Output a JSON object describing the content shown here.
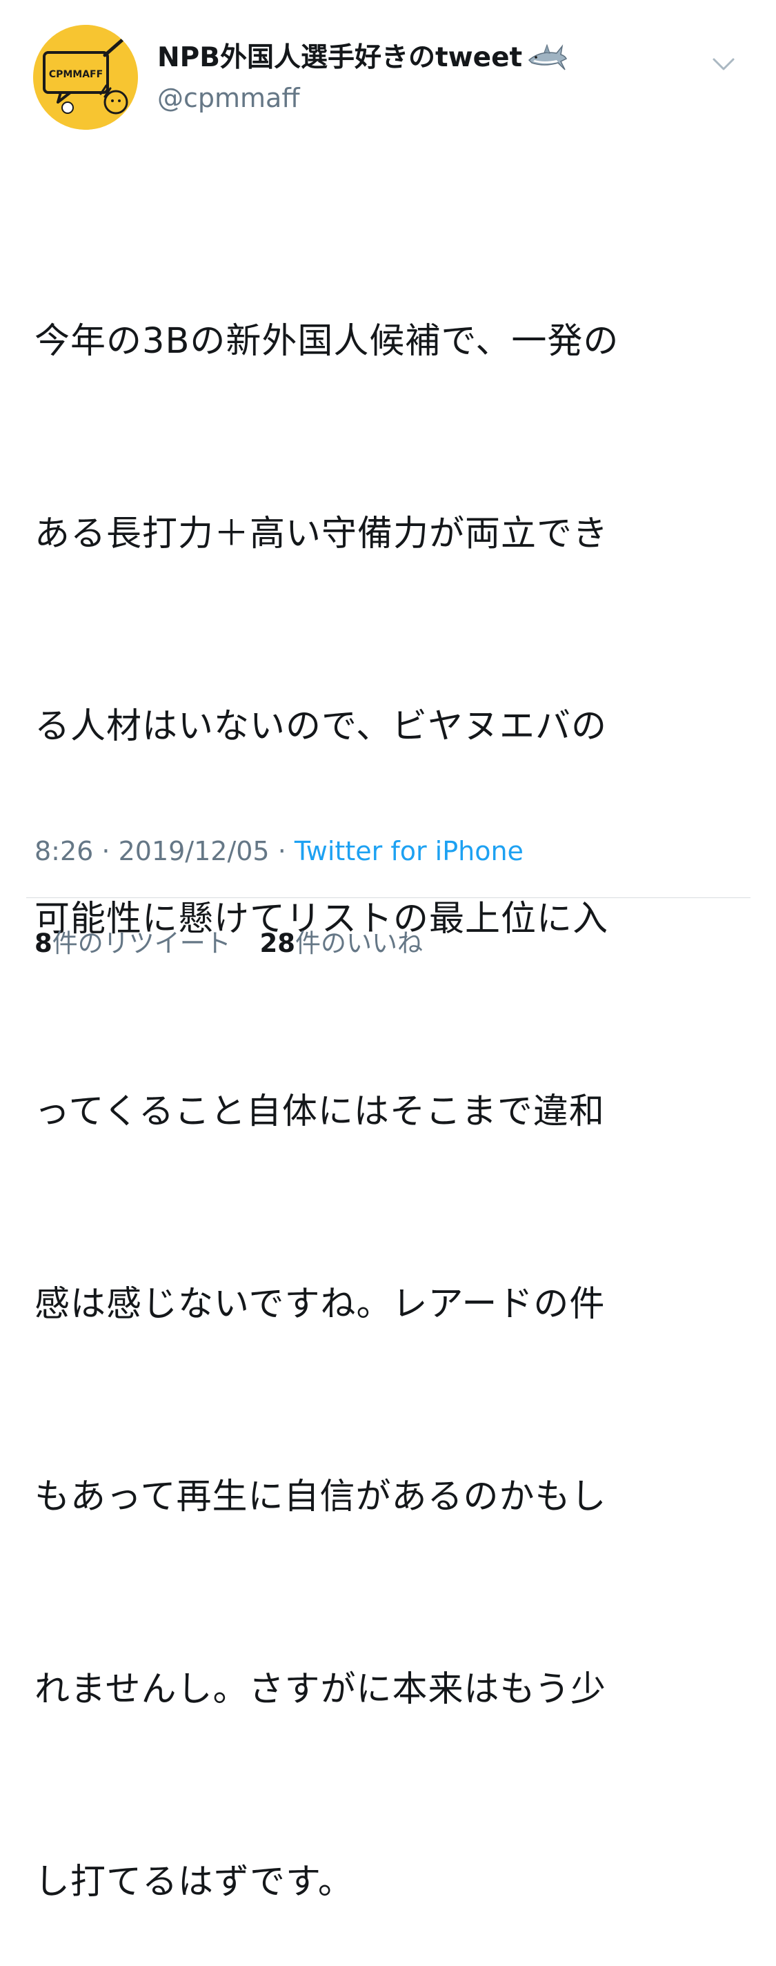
{
  "user": {
    "display_name": "NPB外国人選手好きのtweet",
    "emoji": "🦈",
    "handle": "@cpmmaff",
    "avatar_text": "CPMMAFF"
  },
  "tweet": {
    "lines": [
      "今年の3Bの新外国人候補で、一発の",
      "ある長打力＋高い守備力が両立でき",
      "る人材はいないので、ビヤヌエバの",
      "可能性に懸けてリストの最上位に入",
      "ってくること自体にはそこまで違和",
      "感は感じないですね。レアードの件",
      "もあって再生に自信があるのかもし",
      "れませんし。さすがに本来はもう少",
      "し打てるはずです。"
    ]
  },
  "meta": {
    "time": "8:26",
    "separator": " · ",
    "date": "2019/12/05",
    "source": "Twitter for iPhone"
  },
  "stats": {
    "retweets_count": "8",
    "retweets_label": "件のリツイート",
    "likes_count": "28",
    "likes_label": "件のいいね"
  },
  "colors": {
    "accent": "#1da1f2",
    "secondary_text": "#657786",
    "avatar_bg": "#f7c531"
  },
  "icons": {
    "avatar": "avatar-icon",
    "emoji": "shark-icon",
    "menu": "chevron-down-icon"
  }
}
